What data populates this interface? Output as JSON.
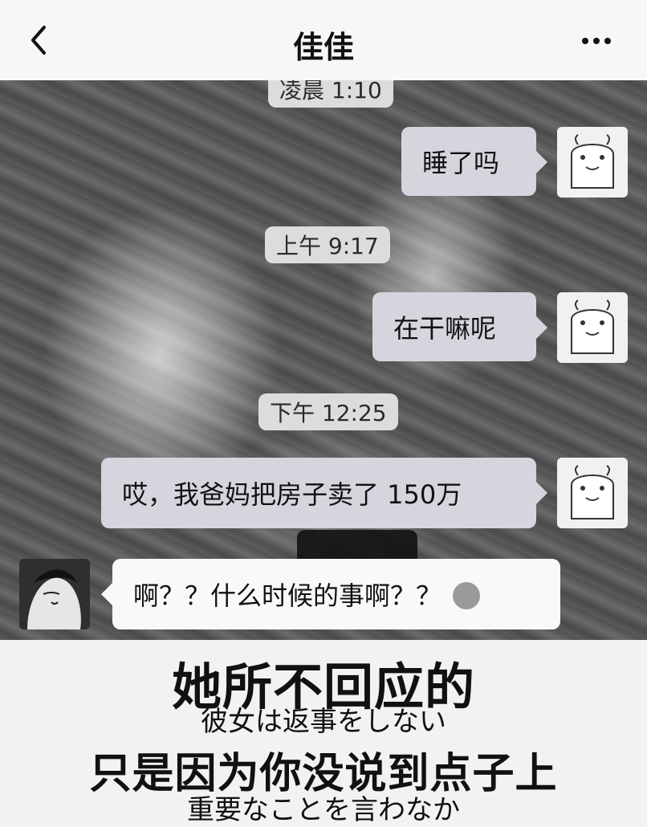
{
  "header": {
    "title": "佳佳"
  },
  "messages": [
    {
      "type": "time",
      "text": "凌晨 1:10"
    },
    {
      "type": "outgoing",
      "text": "睡了吗"
    },
    {
      "type": "time",
      "text": "上午 9:17"
    },
    {
      "type": "outgoing",
      "text": "在干嘛呢"
    },
    {
      "type": "time",
      "text": "下午 12:25"
    },
    {
      "type": "outgoing",
      "text": "哎，我爸妈把房子卖了 150万"
    },
    {
      "type": "incoming",
      "text": "啊？？什么时候的事啊？？"
    }
  ],
  "subtitles": {
    "zh_1": "她所不回应的",
    "jp_1": "彼女は返事をしない",
    "zh_2": "只是因为你没说到点子上",
    "jp_2": "重要なことを言わなか"
  },
  "colors": {
    "header_bg": "#f7f7f7",
    "outgoing_bubble": "#d7d4de",
    "incoming_bubble": "#f9f9f9",
    "timestamp_bg": "#dcdcdc"
  }
}
